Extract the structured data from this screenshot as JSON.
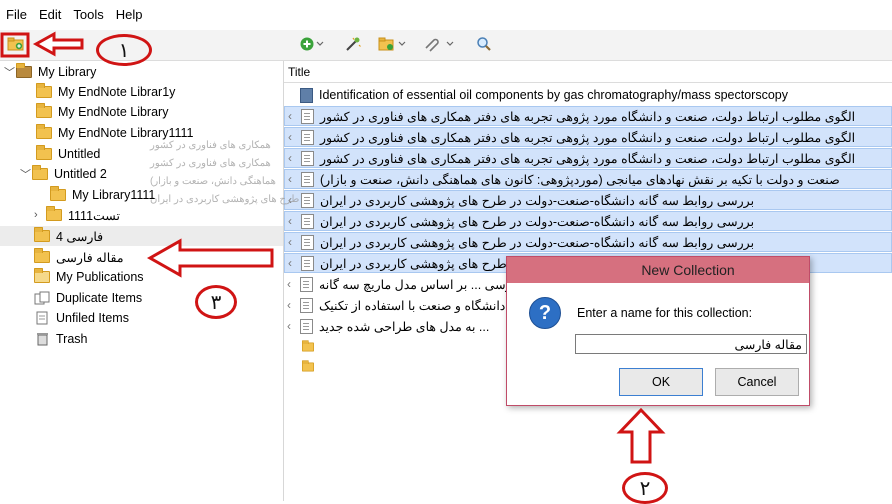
{
  "menu": [
    "File",
    "Edit",
    "Tools",
    "Help"
  ],
  "library": {
    "root": "My Library",
    "collections": [
      "My EndNote Librar1y",
      "My EndNote Library",
      "My EndNote Library1111",
      "Untitled",
      "Untitled 2",
      "My Library1111",
      "تست1111",
      "فارسی 4",
      "مقاله فارسی",
      "My Publications",
      "Duplicate Items",
      "Unfiled Items",
      "Trash"
    ]
  },
  "items": {
    "column_title": "Title",
    "rows": [
      "Identification of essential oil components by gas chromatography/mass spectorscopy",
      "الگوی مطلوب ارتباط دولت، صنعت و دانشگاه مورد پژوهی تجربه های دفتر همکاری های فناوری در کشور",
      "الگوی مطلوب ارتباط دولت، صنعت و دانشگاه مورد پژوهی تجربه های دفتر همکاری های فناوری در کشور",
      "الگوی مطلوب ارتباط دولت، صنعت و دانشگاه مورد پژوهی تجربه های دفتر همکاری های فناوری در کشور",
      "صنعت و دولت با تکیه بر نقش نهادهای میانجی (موردپژوهی: کانون های هماهنگی دانش، صنعت و بازار)",
      "بررسی روابط سه گانه دانشگاه-صنعت-دولت در طرح های پژوهشی کاربردی در ایران",
      "بررسی روابط سه گانه دانشگاه-صنعت-دولت در طرح های پژوهشی کاربردی در ایران",
      "بررسی روابط سه گانه دانشگاه-صنعت-دولت در طرح های پژوهشی کاربردی در ایران",
      "بررسی روابط سه گانه دانشگاه-صنعت-دولت در طرح های پژوهشی کاربردی در ایران",
      "بررسی ... بر اساس مدل ماریچ سه گانه",
      "دانشگاه و صنعت با استفاده از تکنیک",
      "... به مدل های طراحی شده جدید"
    ]
  },
  "dialog": {
    "title": "New Collection",
    "prompt": "Enter a name for this collection:",
    "value": "مقاله فارسی",
    "ok": "OK",
    "cancel": "Cancel"
  },
  "annotations": {
    "one": "١",
    "two": "٢",
    "three": "٣"
  },
  "drag_ghost": [
    "همکاری های فناوری در کشور",
    "همکاری های فناوری در کشور",
    "هماهنگی دانش، صنعت و بازار)",
    "طرح های پژوهشی کاربردی در ایران"
  ],
  "colors": {
    "arrow": "#d01414",
    "selection": "#d2e3fb",
    "dialog_title": "#d6707f",
    "folder": "#f2c24f"
  }
}
